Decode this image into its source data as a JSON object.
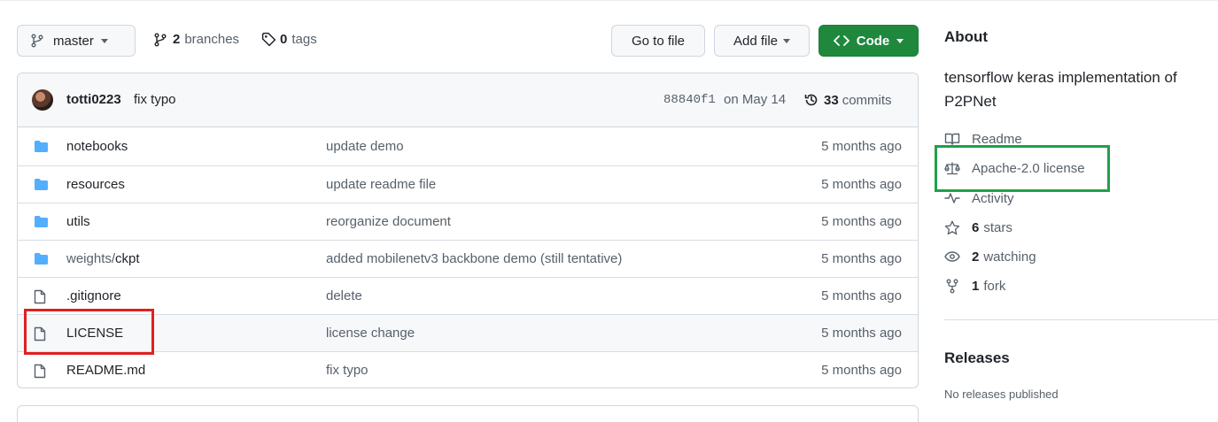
{
  "toolbar": {
    "branch_label": "master",
    "branches_count": "2",
    "branches_label": "branches",
    "tags_count": "0",
    "tags_label": "tags",
    "goto_label": "Go to file",
    "addfile_label": "Add file",
    "code_label": "Code",
    "code_color": "#1f883d"
  },
  "commit": {
    "author": "totti0223",
    "message": "fix typo",
    "sha": "88840f1",
    "date": "on May 14",
    "count": "33",
    "count_label": "commits"
  },
  "files": [
    {
      "type": "folder",
      "name": "notebooks",
      "message": "update demo",
      "age": "5 months ago"
    },
    {
      "type": "folder",
      "name": "resources",
      "message": "update readme file",
      "age": "5 months ago"
    },
    {
      "type": "folder",
      "name": "utils",
      "message": "reorganize document",
      "age": "5 months ago"
    },
    {
      "type": "folder",
      "name_prefix": "weights/",
      "name": "ckpt",
      "message": "added mobilenetv3 backbone demo (still tentative)",
      "age": "5 months ago"
    },
    {
      "type": "file",
      "name": ".gitignore",
      "message": "delete",
      "age": "5 months ago"
    },
    {
      "type": "file",
      "name": "LICENSE",
      "message": "license change",
      "age": "5 months ago"
    },
    {
      "type": "file",
      "name": "README.md",
      "message": "fix typo",
      "age": "5 months ago"
    }
  ],
  "sidebar": {
    "about_title": "About",
    "description": "tensorflow keras implementation of P2PNet",
    "readme": "Readme",
    "license": "Apache-2.0 license",
    "activity": "Activity",
    "stars_count": "6",
    "stars_label": "stars",
    "watching_count": "2",
    "watching_label": "watching",
    "fork_count": "1",
    "fork_label": "fork",
    "releases_title": "Releases",
    "releases_note": "No releases published"
  },
  "colors": {
    "folder_icon": "#54aeff",
    "highlight_red": "#e02020",
    "highlight_green": "#1fa14a"
  }
}
